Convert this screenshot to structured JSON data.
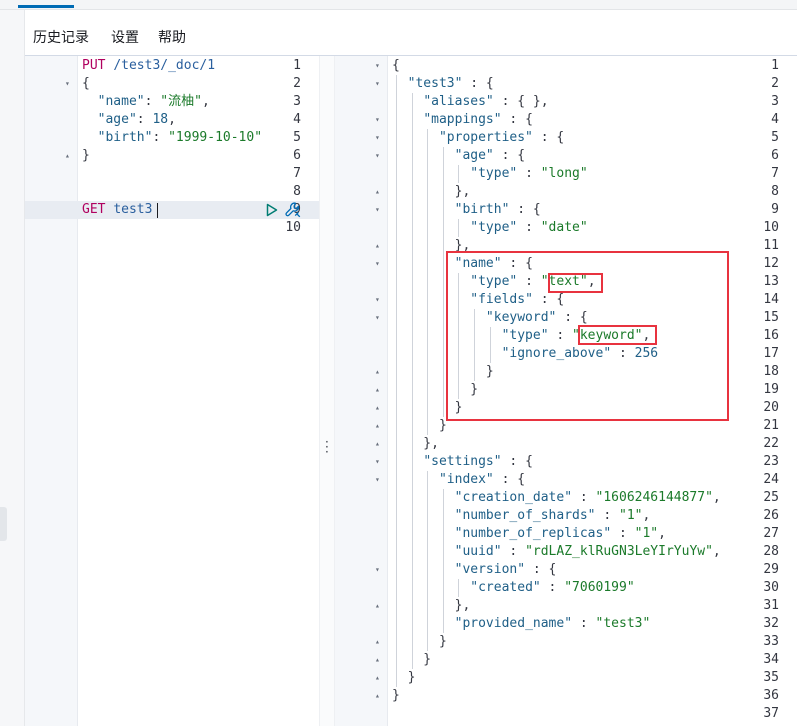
{
  "menu": [
    "历史记录",
    "设置",
    "帮助"
  ],
  "left_editor": {
    "lines": [
      {
        "n": "1",
        "fold": "",
        "segs": [
          [
            "m",
            "PUT "
          ],
          [
            "u",
            "/test3/_doc/1"
          ]
        ]
      },
      {
        "n": "2",
        "fold": "▾",
        "segs": [
          [
            "p",
            "{"
          ]
        ]
      },
      {
        "n": "3",
        "fold": "",
        "segs": [
          [
            "p",
            "  "
          ],
          [
            "k",
            "\"name\""
          ],
          [
            "p",
            ": "
          ],
          [
            "s",
            "\"流柚\""
          ],
          [
            "p",
            ","
          ]
        ]
      },
      {
        "n": "4",
        "fold": "",
        "segs": [
          [
            "p",
            "  "
          ],
          [
            "k",
            "\"age\""
          ],
          [
            "p",
            ": "
          ],
          [
            "n",
            "18"
          ],
          [
            "p",
            ","
          ]
        ]
      },
      {
        "n": "5",
        "fold": "",
        "segs": [
          [
            "p",
            "  "
          ],
          [
            "k",
            "\"birth\""
          ],
          [
            "p",
            ": "
          ],
          [
            "s",
            "\"1999-10-10\""
          ]
        ]
      },
      {
        "n": "6",
        "fold": "▴",
        "segs": [
          [
            "p",
            "}"
          ]
        ]
      },
      {
        "n": "7",
        "fold": "",
        "segs": []
      },
      {
        "n": "8",
        "fold": "",
        "segs": []
      },
      {
        "n": "9",
        "fold": "",
        "segs": [
          [
            "m",
            "GET "
          ],
          [
            "u",
            "test3"
          ]
        ]
      },
      {
        "n": "10",
        "fold": "",
        "segs": []
      }
    ]
  },
  "right_editor": {
    "lines": [
      {
        "n": "1",
        "fold": "▾",
        "segs": [
          [
            "p",
            "{"
          ]
        ]
      },
      {
        "n": "2",
        "fold": "▾",
        "segs": [
          [
            "p",
            "  "
          ],
          [
            "k",
            "\"test3\""
          ],
          [
            "p",
            " : {"
          ]
        ]
      },
      {
        "n": "3",
        "fold": "",
        "segs": [
          [
            "p",
            "    "
          ],
          [
            "k",
            "\"aliases\""
          ],
          [
            "p",
            " : { },"
          ]
        ]
      },
      {
        "n": "4",
        "fold": "▾",
        "segs": [
          [
            "p",
            "    "
          ],
          [
            "k",
            "\"mappings\""
          ],
          [
            "p",
            " : {"
          ]
        ]
      },
      {
        "n": "5",
        "fold": "▾",
        "segs": [
          [
            "p",
            "      "
          ],
          [
            "k",
            "\"properties\""
          ],
          [
            "p",
            " : {"
          ]
        ]
      },
      {
        "n": "6",
        "fold": "▾",
        "segs": [
          [
            "p",
            "        "
          ],
          [
            "k",
            "\"age\""
          ],
          [
            "p",
            " : {"
          ]
        ]
      },
      {
        "n": "7",
        "fold": "",
        "segs": [
          [
            "p",
            "          "
          ],
          [
            "k",
            "\"type\""
          ],
          [
            "p",
            " : "
          ],
          [
            "s",
            "\"long\""
          ]
        ]
      },
      {
        "n": "8",
        "fold": "▴",
        "segs": [
          [
            "p",
            "        },"
          ]
        ]
      },
      {
        "n": "9",
        "fold": "▾",
        "segs": [
          [
            "p",
            "        "
          ],
          [
            "k",
            "\"birth\""
          ],
          [
            "p",
            " : {"
          ]
        ]
      },
      {
        "n": "10",
        "fold": "",
        "segs": [
          [
            "p",
            "          "
          ],
          [
            "k",
            "\"type\""
          ],
          [
            "p",
            " : "
          ],
          [
            "s",
            "\"date\""
          ]
        ]
      },
      {
        "n": "11",
        "fold": "▴",
        "segs": [
          [
            "p",
            "        },"
          ]
        ]
      },
      {
        "n": "12",
        "fold": "▾",
        "segs": [
          [
            "p",
            "        "
          ],
          [
            "k",
            "\"name\""
          ],
          [
            "p",
            " : {"
          ]
        ]
      },
      {
        "n": "13",
        "fold": "",
        "segs": [
          [
            "p",
            "          "
          ],
          [
            "k",
            "\"type\""
          ],
          [
            "p",
            " : "
          ],
          [
            "s",
            "\"text\""
          ],
          [
            "p",
            ","
          ]
        ]
      },
      {
        "n": "14",
        "fold": "▾",
        "segs": [
          [
            "p",
            "          "
          ],
          [
            "k",
            "\"fields\""
          ],
          [
            "p",
            " : {"
          ]
        ]
      },
      {
        "n": "15",
        "fold": "▾",
        "segs": [
          [
            "p",
            "            "
          ],
          [
            "k",
            "\"keyword\""
          ],
          [
            "p",
            " : {"
          ]
        ]
      },
      {
        "n": "16",
        "fold": "",
        "segs": [
          [
            "p",
            "              "
          ],
          [
            "k",
            "\"type\""
          ],
          [
            "p",
            " : "
          ],
          [
            "s",
            "\"keyword\""
          ],
          [
            "p",
            ","
          ]
        ]
      },
      {
        "n": "17",
        "fold": "",
        "segs": [
          [
            "p",
            "              "
          ],
          [
            "k",
            "\"ignore_above\""
          ],
          [
            "p",
            " : "
          ],
          [
            "n",
            "256"
          ]
        ]
      },
      {
        "n": "18",
        "fold": "▴",
        "segs": [
          [
            "p",
            "            }"
          ]
        ]
      },
      {
        "n": "19",
        "fold": "▴",
        "segs": [
          [
            "p",
            "          }"
          ]
        ]
      },
      {
        "n": "20",
        "fold": "▴",
        "segs": [
          [
            "p",
            "        }"
          ]
        ]
      },
      {
        "n": "21",
        "fold": "▴",
        "segs": [
          [
            "p",
            "      }"
          ]
        ]
      },
      {
        "n": "22",
        "fold": "▴",
        "segs": [
          [
            "p",
            "    },"
          ]
        ]
      },
      {
        "n": "23",
        "fold": "▾",
        "segs": [
          [
            "p",
            "    "
          ],
          [
            "k",
            "\"settings\""
          ],
          [
            "p",
            " : {"
          ]
        ]
      },
      {
        "n": "24",
        "fold": "▾",
        "segs": [
          [
            "p",
            "      "
          ],
          [
            "k",
            "\"index\""
          ],
          [
            "p",
            " : {"
          ]
        ]
      },
      {
        "n": "25",
        "fold": "",
        "segs": [
          [
            "p",
            "        "
          ],
          [
            "k",
            "\"creation_date\""
          ],
          [
            "p",
            " : "
          ],
          [
            "s",
            "\"1606246144877\""
          ],
          [
            "p",
            ","
          ]
        ]
      },
      {
        "n": "26",
        "fold": "",
        "segs": [
          [
            "p",
            "        "
          ],
          [
            "k",
            "\"number_of_shards\""
          ],
          [
            "p",
            " : "
          ],
          [
            "s",
            "\"1\""
          ],
          [
            "p",
            ","
          ]
        ]
      },
      {
        "n": "27",
        "fold": "",
        "segs": [
          [
            "p",
            "        "
          ],
          [
            "k",
            "\"number_of_replicas\""
          ],
          [
            "p",
            " : "
          ],
          [
            "s",
            "\"1\""
          ],
          [
            "p",
            ","
          ]
        ]
      },
      {
        "n": "28",
        "fold": "",
        "segs": [
          [
            "p",
            "        "
          ],
          [
            "k",
            "\"uuid\""
          ],
          [
            "p",
            " : "
          ],
          [
            "s",
            "\"rdLAZ_klRuGN3LeYIrYuYw\""
          ],
          [
            "p",
            ","
          ]
        ]
      },
      {
        "n": "29",
        "fold": "▾",
        "segs": [
          [
            "p",
            "        "
          ],
          [
            "k",
            "\"version\""
          ],
          [
            "p",
            " : {"
          ]
        ]
      },
      {
        "n": "30",
        "fold": "",
        "segs": [
          [
            "p",
            "          "
          ],
          [
            "k",
            "\"created\""
          ],
          [
            "p",
            " : "
          ],
          [
            "s",
            "\"7060199\""
          ]
        ]
      },
      {
        "n": "31",
        "fold": "▴",
        "segs": [
          [
            "p",
            "        },"
          ]
        ]
      },
      {
        "n": "32",
        "fold": "",
        "segs": [
          [
            "p",
            "        "
          ],
          [
            "k",
            "\"provided_name\""
          ],
          [
            "p",
            " : "
          ],
          [
            "s",
            "\"test3\""
          ]
        ]
      },
      {
        "n": "33",
        "fold": "▴",
        "segs": [
          [
            "p",
            "      }"
          ]
        ]
      },
      {
        "n": "34",
        "fold": "▴",
        "segs": [
          [
            "p",
            "    }"
          ]
        ]
      },
      {
        "n": "35",
        "fold": "▴",
        "segs": [
          [
            "p",
            "  }"
          ]
        ]
      },
      {
        "n": "36",
        "fold": "▴",
        "segs": [
          [
            "p",
            "}"
          ]
        ]
      },
      {
        "n": "37",
        "fold": "",
        "segs": []
      }
    ]
  },
  "colors": {
    "accent": "#006bb4",
    "highlight_box": "#e8333f",
    "method": "#b0005f",
    "string": "#1b7a2a",
    "key": "#1f5f87"
  },
  "icons": [
    "play-icon",
    "wrench-icon",
    "drag-handle-icon"
  ]
}
